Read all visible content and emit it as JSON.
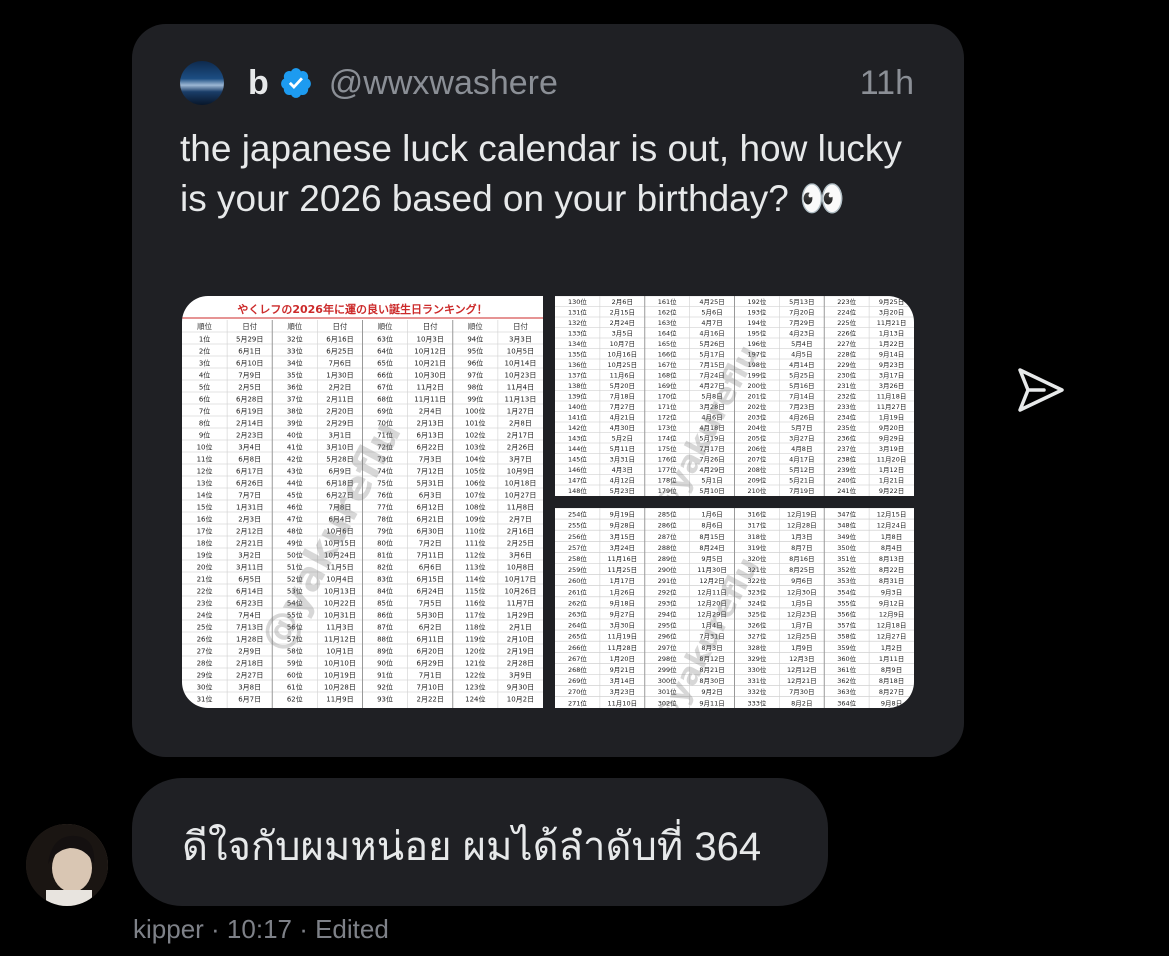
{
  "quoted_tweet": {
    "author_name": "b",
    "handle": "@wwxwashere",
    "time": "11h",
    "text": "the japanese luck calendar is out, how lucky is your 2026 based on your birthday? 👀",
    "media": {
      "main_title": "やくレフの2026年に運の良い誕生日ランキング！",
      "header_rank": "順位",
      "header_date": "日付",
      "watermark": "@yakureflu",
      "table_main": [
        [
          "1位",
          "5月29日",
          "32位",
          "6月16日",
          "63位",
          "10月3日",
          "94位",
          "3月3日"
        ],
        [
          "2位",
          "6月1日",
          "33位",
          "6月25日",
          "64位",
          "10月12日",
          "95位",
          "10月5日"
        ],
        [
          "3位",
          "6月10日",
          "34位",
          "7月6日",
          "65位",
          "10月21日",
          "96位",
          "10月14日"
        ],
        [
          "4位",
          "7月9日",
          "35位",
          "1月30日",
          "66位",
          "10月30日",
          "97位",
          "10月23日"
        ],
        [
          "5位",
          "2月5日",
          "36位",
          "2月2日",
          "67位",
          "11月2日",
          "98位",
          "11月4日"
        ],
        [
          "6位",
          "6月28日",
          "37位",
          "2月11日",
          "68位",
          "11月11日",
          "99位",
          "11月13日"
        ],
        [
          "7位",
          "6月19日",
          "38位",
          "2月20日",
          "69位",
          "2月4日",
          "100位",
          "1月27日"
        ],
        [
          "8位",
          "2月14日",
          "39位",
          "2月29日",
          "70位",
          "2月13日",
          "101位",
          "2月8日"
        ],
        [
          "9位",
          "2月23日",
          "40位",
          "3月1日",
          "71位",
          "6月13日",
          "102位",
          "2月17日"
        ],
        [
          "10位",
          "3月4日",
          "41位",
          "3月10日",
          "72位",
          "6月22日",
          "103位",
          "2月26日"
        ],
        [
          "11位",
          "6月8日",
          "42位",
          "5月28日",
          "73位",
          "7月3日",
          "104位",
          "3月7日"
        ],
        [
          "12位",
          "6月17日",
          "43位",
          "6月9日",
          "74位",
          "7月12日",
          "105位",
          "10月9日"
        ],
        [
          "13位",
          "6月26日",
          "44位",
          "6月18日",
          "75位",
          "5月31日",
          "106位",
          "10月18日"
        ],
        [
          "14位",
          "7月7日",
          "45位",
          "6月27日",
          "76位",
          "6月3日",
          "107位",
          "10月27日"
        ],
        [
          "15位",
          "1月31日",
          "46位",
          "7月8日",
          "77位",
          "6月12日",
          "108位",
          "11月8日"
        ],
        [
          "16位",
          "2月3日",
          "47位",
          "6月4日",
          "78位",
          "6月21日",
          "109位",
          "2月7日"
        ],
        [
          "17位",
          "2月12日",
          "48位",
          "10月6日",
          "79位",
          "6月30日",
          "110位",
          "2月16日"
        ],
        [
          "18位",
          "2月21日",
          "49位",
          "10月15日",
          "80位",
          "7月2日",
          "111位",
          "2月25日"
        ],
        [
          "19位",
          "3月2日",
          "50位",
          "10月24日",
          "81位",
          "7月11日",
          "112位",
          "3月6日"
        ],
        [
          "20位",
          "3月11日",
          "51位",
          "11月5日",
          "82位",
          "6月6日",
          "113位",
          "10月8日"
        ],
        [
          "21位",
          "6月5日",
          "52位",
          "10月4日",
          "83位",
          "6月15日",
          "114位",
          "10月17日"
        ],
        [
          "22位",
          "6月14日",
          "53位",
          "10月13日",
          "84位",
          "6月24日",
          "115位",
          "10月26日"
        ],
        [
          "23位",
          "6月23日",
          "54位",
          "10月22日",
          "85位",
          "7月5日",
          "116位",
          "11月7日"
        ],
        [
          "24位",
          "7月4日",
          "55位",
          "10月31日",
          "86位",
          "5月30日",
          "117位",
          "1月29日"
        ],
        [
          "25位",
          "7月13日",
          "56位",
          "11月3日",
          "87位",
          "6月2日",
          "118位",
          "2月1日"
        ],
        [
          "26位",
          "1月28日",
          "57位",
          "11月12日",
          "88位",
          "6月11日",
          "119位",
          "2月10日"
        ],
        [
          "27位",
          "2月9日",
          "58位",
          "10月1日",
          "89位",
          "6月20日",
          "120位",
          "2月19日"
        ],
        [
          "28位",
          "2月18日",
          "59位",
          "10月10日",
          "90位",
          "6月29日",
          "121位",
          "2月28日"
        ],
        [
          "29位",
          "2月27日",
          "60位",
          "10月19日",
          "91位",
          "7月1日",
          "122位",
          "3月9日"
        ],
        [
          "30位",
          "3月8日",
          "61位",
          "10月28日",
          "92位",
          "7月10日",
          "123位",
          "9月30日"
        ],
        [
          "31位",
          "6月7日",
          "62位",
          "11月9日",
          "93位",
          "2月22日",
          "124位",
          "10月2日"
        ]
      ],
      "table_top_right": [
        [
          "130位",
          "2月6日",
          "161位",
          "4月25日",
          "192位",
          "5月13日",
          "223位",
          "9月25日"
        ],
        [
          "131位",
          "2月15日",
          "162位",
          "5月6日",
          "193位",
          "7月20日",
          "224位",
          "3月20日"
        ],
        [
          "132位",
          "2月24日",
          "163位",
          "4月7日",
          "194位",
          "7月29日",
          "225位",
          "11月21日"
        ],
        [
          "133位",
          "3月5日",
          "164位",
          "4月16日",
          "195位",
          "4月23日",
          "226位",
          "1月13日"
        ],
        [
          "134位",
          "10月7日",
          "165位",
          "5月26日",
          "196位",
          "5月4日",
          "227位",
          "1月22日"
        ],
        [
          "135位",
          "10月16日",
          "166位",
          "5月17日",
          "197位",
          "4月5日",
          "228位",
          "9月14日"
        ],
        [
          "136位",
          "10月25日",
          "167位",
          "7月15日",
          "198位",
          "4月14日",
          "229位",
          "9月23日"
        ],
        [
          "137位",
          "11月6日",
          "168位",
          "7月24日",
          "199位",
          "5月25日",
          "230位",
          "3月17日"
        ],
        [
          "138位",
          "5月20日",
          "169位",
          "4月27日",
          "200位",
          "5月16日",
          "231位",
          "3月26日"
        ],
        [
          "139位",
          "7月18日",
          "170位",
          "5月8日",
          "201位",
          "7月14日",
          "232位",
          "11月18日"
        ],
        [
          "140位",
          "7月27日",
          "171位",
          "3月28日",
          "202位",
          "7月23日",
          "233位",
          "11月27日"
        ],
        [
          "141位",
          "4月21日",
          "172位",
          "4月6日",
          "203位",
          "4月26日",
          "234位",
          "1月19日"
        ],
        [
          "142位",
          "4月30日",
          "173位",
          "4月18日",
          "204位",
          "5月7日",
          "235位",
          "9月20日"
        ],
        [
          "143位",
          "5月2日",
          "174位",
          "5月19日",
          "205位",
          "3月27日",
          "236位",
          "9月29日"
        ],
        [
          "144位",
          "5月11日",
          "175位",
          "7月17日",
          "206位",
          "4月8日",
          "237位",
          "3月19日"
        ],
        [
          "145位",
          "3月31日",
          "176位",
          "7月26日",
          "207位",
          "4月17日",
          "238位",
          "11月20日"
        ],
        [
          "146位",
          "4月3日",
          "177位",
          "4月29日",
          "208位",
          "5月12日",
          "239位",
          "1月12日"
        ],
        [
          "147位",
          "4月12日",
          "178位",
          "5月1日",
          "209位",
          "5月21日",
          "240位",
          "1月21日"
        ],
        [
          "148位",
          "5月23日",
          "179位",
          "5月10日",
          "210位",
          "7月19日",
          "241位",
          "9月22日"
        ]
      ],
      "table_bottom_right": [
        [
          "254位",
          "9月19日",
          "285位",
          "1月6日",
          "316位",
          "12月19日",
          "347位",
          "12月15日"
        ],
        [
          "255位",
          "9月28日",
          "286位",
          "8月6日",
          "317位",
          "12月28日",
          "348位",
          "12月24日"
        ],
        [
          "256位",
          "3月15日",
          "287位",
          "8月15日",
          "318位",
          "1月3日",
          "349位",
          "1月8日"
        ],
        [
          "257位",
          "3月24日",
          "288位",
          "8月24日",
          "319位",
          "8月7日",
          "350位",
          "8月4日"
        ],
        [
          "258位",
          "11月16日",
          "289位",
          "9月5日",
          "320位",
          "8月16日",
          "351位",
          "8月13日"
        ],
        [
          "259位",
          "11月25日",
          "290位",
          "11月30日",
          "321位",
          "8月25日",
          "352位",
          "8月22日"
        ],
        [
          "260位",
          "1月17日",
          "291位",
          "12月2日",
          "322位",
          "9月6日",
          "353位",
          "8月31日"
        ],
        [
          "261位",
          "1月26日",
          "292位",
          "12月11日",
          "323位",
          "12月30日",
          "354位",
          "9月3日"
        ],
        [
          "262位",
          "9月18日",
          "293位",
          "12月20日",
          "324位",
          "1月5日",
          "355位",
          "9月12日"
        ],
        [
          "263位",
          "9月27日",
          "294位",
          "12月29日",
          "325位",
          "12月23日",
          "356位",
          "12月9日"
        ],
        [
          "264位",
          "3月30日",
          "295位",
          "1月4日",
          "326位",
          "1月7日",
          "357位",
          "12月18日"
        ],
        [
          "265位",
          "11月19日",
          "296位",
          "7月31日",
          "327位",
          "12月25日",
          "358位",
          "12月27日"
        ],
        [
          "266位",
          "11月28日",
          "297位",
          "8月3日",
          "328位",
          "1月9日",
          "359位",
          "1月2日"
        ],
        [
          "267位",
          "1月20日",
          "298位",
          "8月12日",
          "329位",
          "12月3日",
          "360位",
          "1月11日"
        ],
        [
          "268位",
          "9月21日",
          "299位",
          "8月21日",
          "330位",
          "12月12日",
          "361位",
          "8月9日"
        ],
        [
          "269位",
          "3月14日",
          "300位",
          "8月30日",
          "331位",
          "12月21日",
          "362位",
          "8月18日"
        ],
        [
          "270位",
          "3月23日",
          "301位",
          "9月2日",
          "332位",
          "7月30日",
          "363位",
          "8月27日"
        ],
        [
          "271位",
          "11月10日",
          "302位",
          "9月11日",
          "333位",
          "8月2日",
          "364位",
          "9月8日"
        ]
      ]
    }
  },
  "reply": {
    "text": "ดีใจกับผมหน่อย ผมได้ลำดับที่ 364",
    "meta": "kipper · 10:17 · Edited"
  },
  "icons": {
    "send": "send-icon",
    "verified": "verified-badge-icon"
  },
  "colors": {
    "background": "#000000",
    "bubble": "#1f2024",
    "text": "#e7e9ea",
    "muted": "#8b8f96",
    "verified": "#1d9bf0",
    "table_title": "#cc2a2a"
  }
}
